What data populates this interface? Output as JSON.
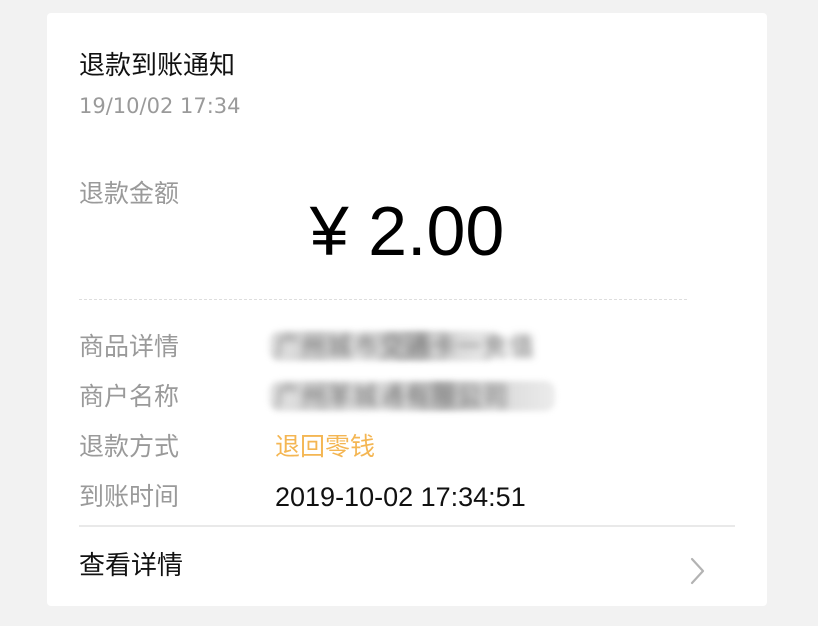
{
  "notification": {
    "title": "退款到账通知",
    "timestamp": "19/10/02 17:34",
    "amount_label": "退款金额",
    "amount": "¥ 2.00"
  },
  "details": [
    {
      "label": "商品详情",
      "value": "广州城市交通卡一充值",
      "redacted": true
    },
    {
      "label": "商户名称",
      "value": "广州羊城通有限公司",
      "redacted": true
    },
    {
      "label": "退款方式",
      "value": "退回零钱",
      "redacted": false
    },
    {
      "label": "到账时间",
      "value": "2019-10-02 17:34:51",
      "redacted": false
    }
  ],
  "footer": {
    "view_details_label": "查看详情",
    "icon": "chevron-right-icon"
  },
  "colors": {
    "accent": "#f4b653",
    "muted_text": "#9a9a9a",
    "primary_text": "#111111",
    "background": "#f2f2f2",
    "card": "#ffffff"
  }
}
